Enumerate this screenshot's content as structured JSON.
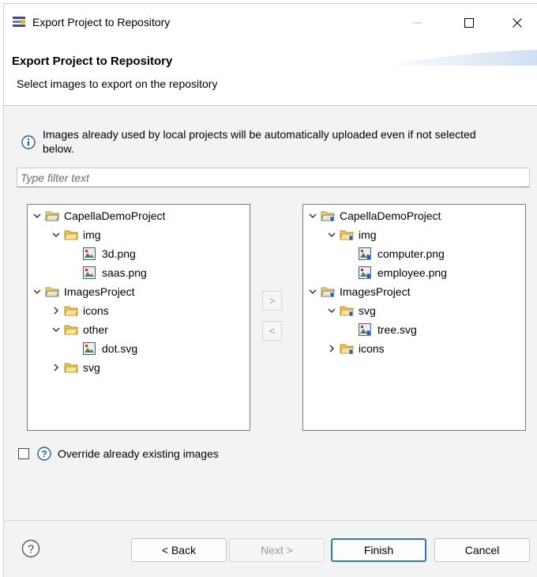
{
  "window": {
    "title": "Export Project to Repository"
  },
  "header": {
    "title": "Export Project to Repository",
    "description": "Select images to export on the repository"
  },
  "info": {
    "text": "Images already used by local projects will be automatically uploaded even if not selected below."
  },
  "filter": {
    "placeholder": "Type filter text",
    "value": ""
  },
  "left_tree": {
    "nodes": [
      {
        "label": "CapellaDemoProject",
        "kind": "project",
        "expanded": true
      },
      {
        "label": "img",
        "kind": "folder",
        "expanded": true
      },
      {
        "label": "3d.png",
        "kind": "image"
      },
      {
        "label": "saas.png",
        "kind": "image"
      },
      {
        "label": "ImagesProject",
        "kind": "project",
        "expanded": true
      },
      {
        "label": "icons",
        "kind": "folder",
        "expanded": false
      },
      {
        "label": "other",
        "kind": "folder",
        "expanded": true
      },
      {
        "label": "dot.svg",
        "kind": "image"
      },
      {
        "label": "svg",
        "kind": "folder",
        "expanded": false
      }
    ]
  },
  "right_tree": {
    "nodes": [
      {
        "label": "CapellaDemoProject",
        "kind": "repo-project",
        "expanded": true
      },
      {
        "label": "img",
        "kind": "repo-folder",
        "expanded": true
      },
      {
        "label": "computer.png",
        "kind": "repo-image"
      },
      {
        "label": "employee.png",
        "kind": "repo-image"
      },
      {
        "label": "ImagesProject",
        "kind": "repo-project",
        "expanded": true
      },
      {
        "label": "svg",
        "kind": "repo-folder",
        "expanded": true
      },
      {
        "label": "tree.svg",
        "kind": "repo-image"
      },
      {
        "label": "icons",
        "kind": "repo-folder",
        "expanded": false
      }
    ]
  },
  "move_buttons": {
    "add": ">",
    "remove": "<"
  },
  "override": {
    "label": "Override already existing images",
    "checked": false
  },
  "footer": {
    "back": "< Back",
    "next": "Next >",
    "finish": "Finish",
    "cancel": "Cancel"
  },
  "colors": {
    "accent": "#2b79c2",
    "folder": "#e9b94a",
    "project_blue": "#3f7fd1",
    "header_swoosh": "#dde8f5"
  }
}
